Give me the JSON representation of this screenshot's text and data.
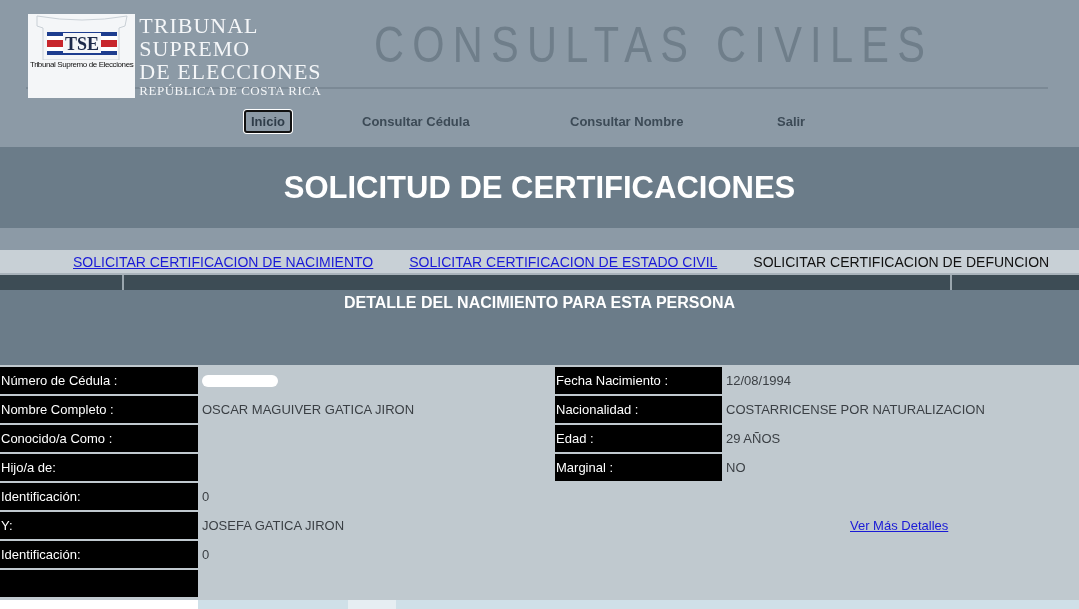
{
  "header": {
    "logo": {
      "letters": "TSE",
      "caption": "Tribunal Supremo de Elecciones"
    },
    "org_line1": "TRIBUNAL SUPREMO",
    "org_line2": "DE ELECCIONES",
    "org_subtitle": "REPÚBLICA DE COSTA RICA",
    "title": "CONSULTAS CIVILES"
  },
  "nav": [
    {
      "label": "Inicio",
      "selected": true
    },
    {
      "label": "Consultar Cédula",
      "selected": false
    },
    {
      "label": "Consultar Nombre",
      "selected": false
    },
    {
      "label": "Salir",
      "selected": false
    }
  ],
  "page_title": "SOLICITUD DE CERTIFICACIONES",
  "certificate_links": [
    {
      "label": "SOLICITAR CERTIFICACION DE NACIMIENTO",
      "selected": false
    },
    {
      "label": "SOLICITAR CERTIFICACION DE ESTADO CIVIL",
      "selected": false
    },
    {
      "label": "SOLICITAR CERTIFICACION DE DEFUNCION",
      "selected": true
    }
  ],
  "section_title": "DETALLE DEL NACIMIENTO PARA ESTA PERSONA",
  "left_fields": [
    {
      "label": "Número de Cédula :",
      "redacted": true
    },
    {
      "label": "Nombre Completo :",
      "value": "OSCAR MAGUIVER GATICA JIRON"
    },
    {
      "label": "Conocido/a Como :"
    },
    {
      "label": "Hijo/a de:"
    },
    {
      "label": "Identificación:",
      "value": "0"
    },
    {
      "label": "Y:",
      "value": "JOSEFA GATICA JIRON"
    },
    {
      "label": "Identificación:",
      "value": "0"
    }
  ],
  "right_fields": [
    {
      "label": "Fecha Nacimiento :",
      "value": "12/08/1994"
    },
    {
      "label": "Nacionalidad :",
      "value": "COSTARRICENSE POR NATURALIZACION"
    },
    {
      "label": "Edad :",
      "value": "29 AÑOS"
    },
    {
      "label": "Marginal :",
      "value": " NO"
    }
  ],
  "more_details_link": "Ver Más Detalles"
}
